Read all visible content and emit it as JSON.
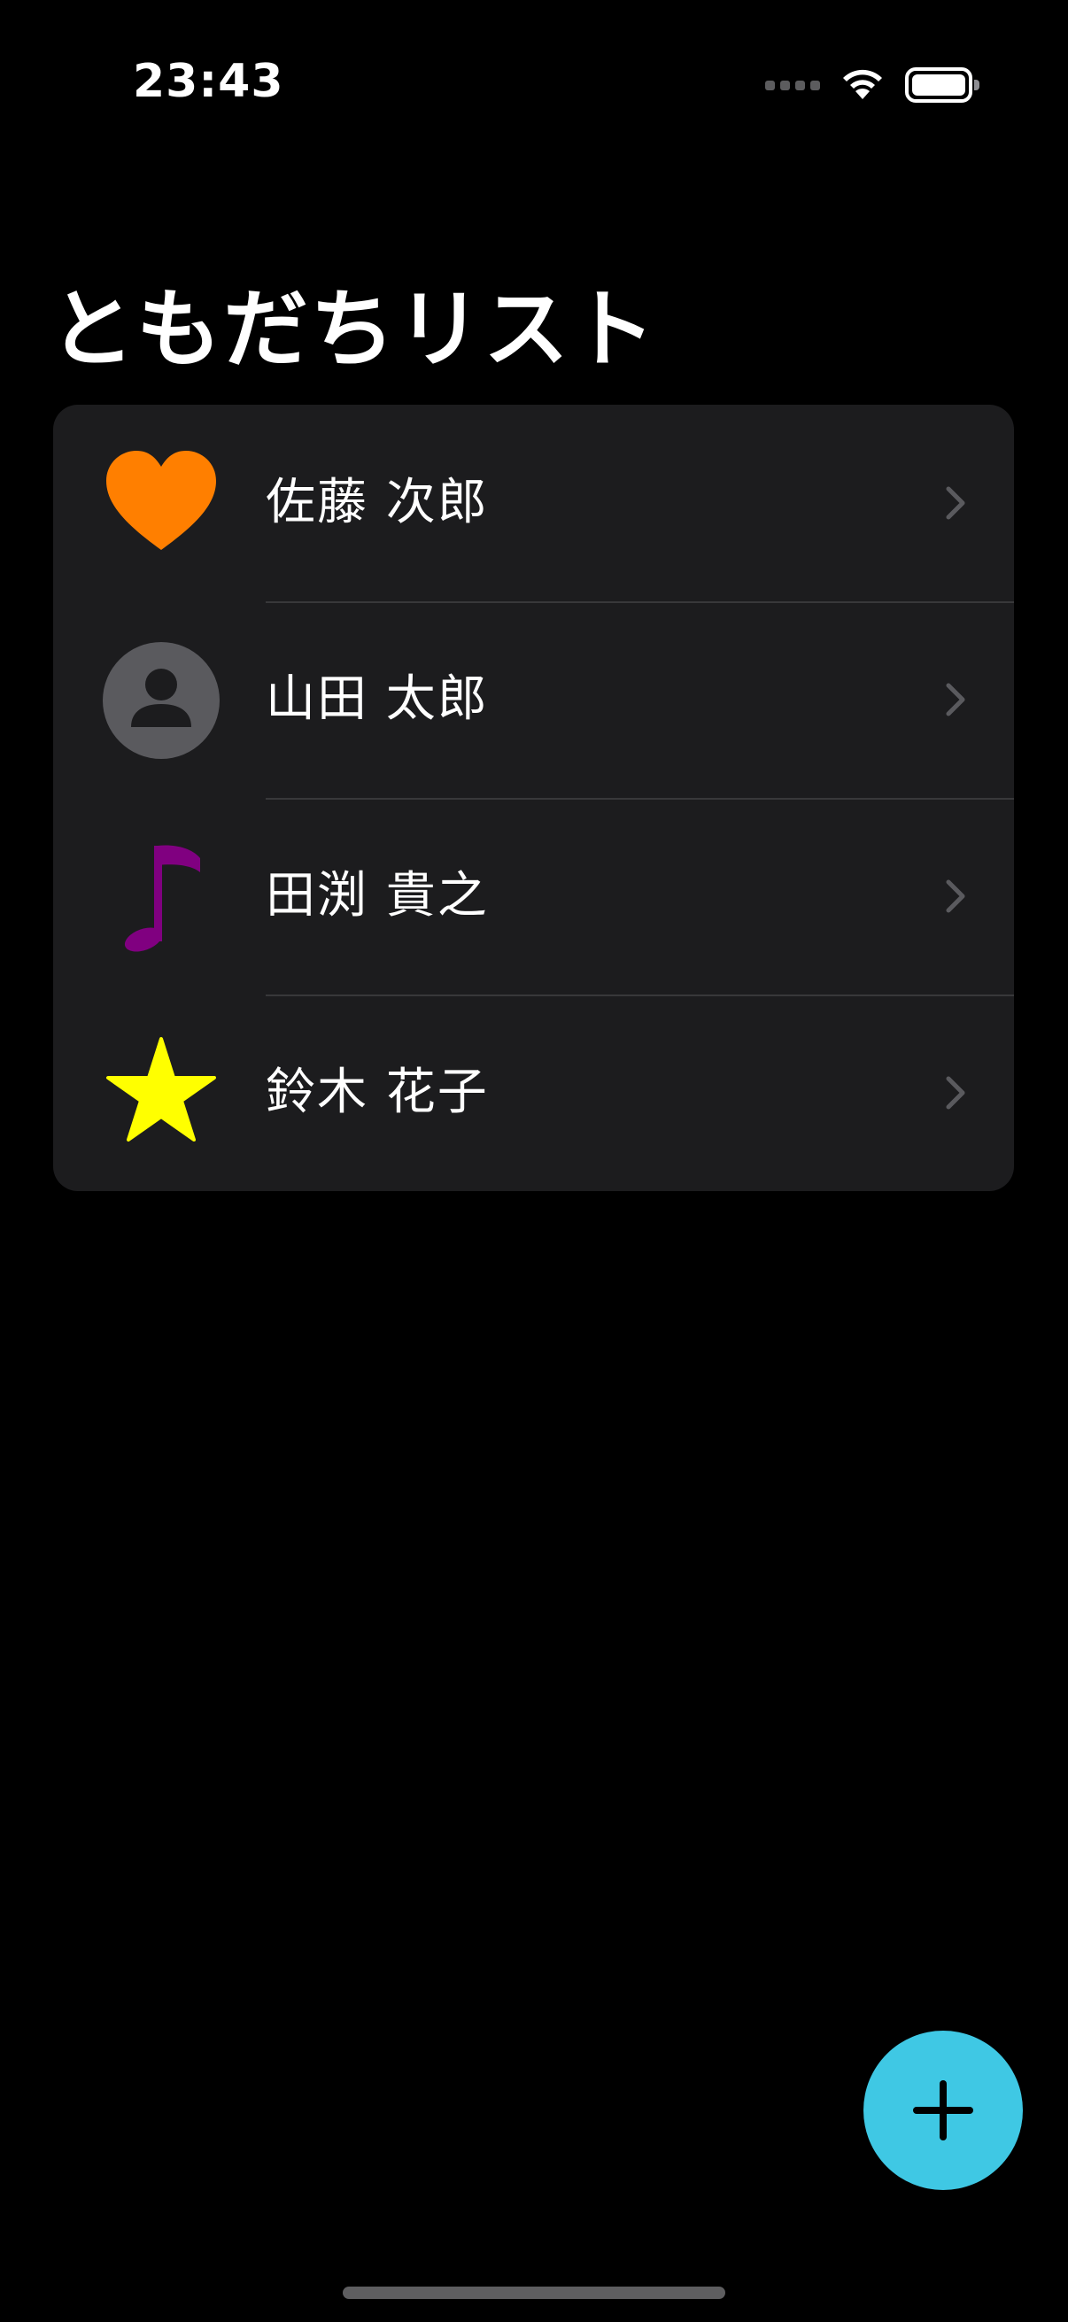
{
  "status_bar": {
    "time": "23:43",
    "wifi_icon": "wifi-icon",
    "battery_icon": "battery-icon"
  },
  "page": {
    "title": "ともだちリスト"
  },
  "friends": [
    {
      "name": "佐藤 次郎",
      "icon": "heart-icon",
      "icon_color": "#ff7f00"
    },
    {
      "name": "山田 太郎",
      "icon": "person-icon",
      "icon_color": "#5a5a5e"
    },
    {
      "name": "田渕 貴之",
      "icon": "music-note-icon",
      "icon_color": "#800080"
    },
    {
      "name": "鈴木 花子",
      "icon": "star-icon",
      "icon_color": "#ffff00"
    }
  ],
  "add_button": {
    "icon": "plus-icon",
    "color": "#3fc8e4"
  },
  "colors": {
    "background": "#000000",
    "list_background": "#1c1c1e",
    "separator": "#38383a",
    "chevron": "#5a5a5e"
  }
}
